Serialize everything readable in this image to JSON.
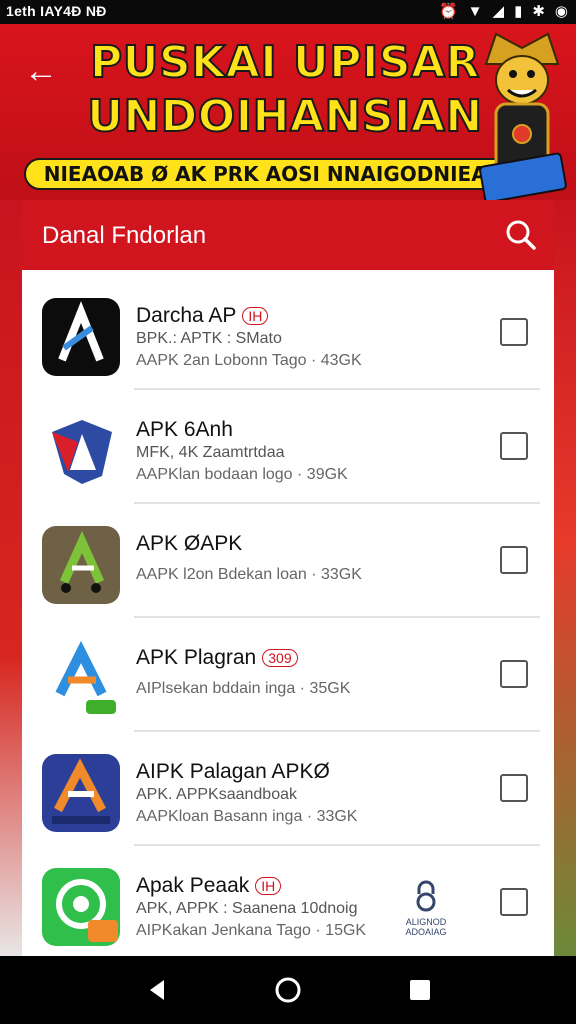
{
  "status_bar": {
    "time": "1eth IAY4Ð NÐ",
    "icons": [
      "alarm-icon",
      "wifi-icon",
      "signal-icon",
      "battery-icon",
      "settings-icon",
      "network-icon"
    ]
  },
  "banner": {
    "headline_line1": "PUSKAI UPISAR",
    "headline_line2": "UNDOIHANSIAN",
    "subline": "NIEAOAB Ø AK PRK AOSI NNAIGODNIEAWG",
    "back_icon": "back-arrow-icon"
  },
  "card": {
    "title": "Danal Fndorlan",
    "search_icon": "search-icon"
  },
  "apps": [
    {
      "name": "Darcha AP",
      "badge": "IH",
      "meta1": "BPK.: APTK : SMato",
      "meta2": "AAPK 2an Lobonn Tago · 43GK",
      "icon_colors": [
        "#0c0c0c",
        "#3a8dde"
      ]
    },
    {
      "name": "APK 6Anh",
      "badge": "",
      "meta1": "MFK, 4K Zaamtrtdaa",
      "meta2": "AAPKlan bodaan logo · 39GK",
      "icon_colors": [
        "#ffffff",
        "#2d4ba3"
      ]
    },
    {
      "name": "APK ØAPK",
      "badge": "",
      "meta1": "",
      "meta2": "AAPK l2on Bdekan loan · 33GK",
      "icon_colors": [
        "#6f6146",
        "#7ec23a"
      ]
    },
    {
      "name": "APK Plagran",
      "badge": "309",
      "meta1": "",
      "meta2": "AIPlsekan bddain inga · 35GK",
      "icon_colors": [
        "#ffffff",
        "#2e8fe0"
      ]
    },
    {
      "name": "AIPK Palagan APKØ",
      "badge": "",
      "meta1": "APK. APPKsaandboak",
      "meta2": "AAPKloan Basann inga · 33GK",
      "icon_colors": [
        "#2c3f98",
        "#f08a2a"
      ]
    },
    {
      "name": "Apak Peaak",
      "badge": "IH",
      "meta1": "APK, APPK : Saanena 10dnoig",
      "meta2": "AIPKakan Jenkana Tago · 15GK",
      "icon_colors": [
        "#2fbf4a",
        "#ffffff"
      ]
    }
  ],
  "lock_widget": {
    "label_line1": "ALIGNOD",
    "label_line2": "ADOAIAG",
    "icon": "lock-icon"
  },
  "nav_bar": {
    "back": "nav-back-icon",
    "home": "nav-home-icon",
    "recents": "nav-recents-icon"
  }
}
